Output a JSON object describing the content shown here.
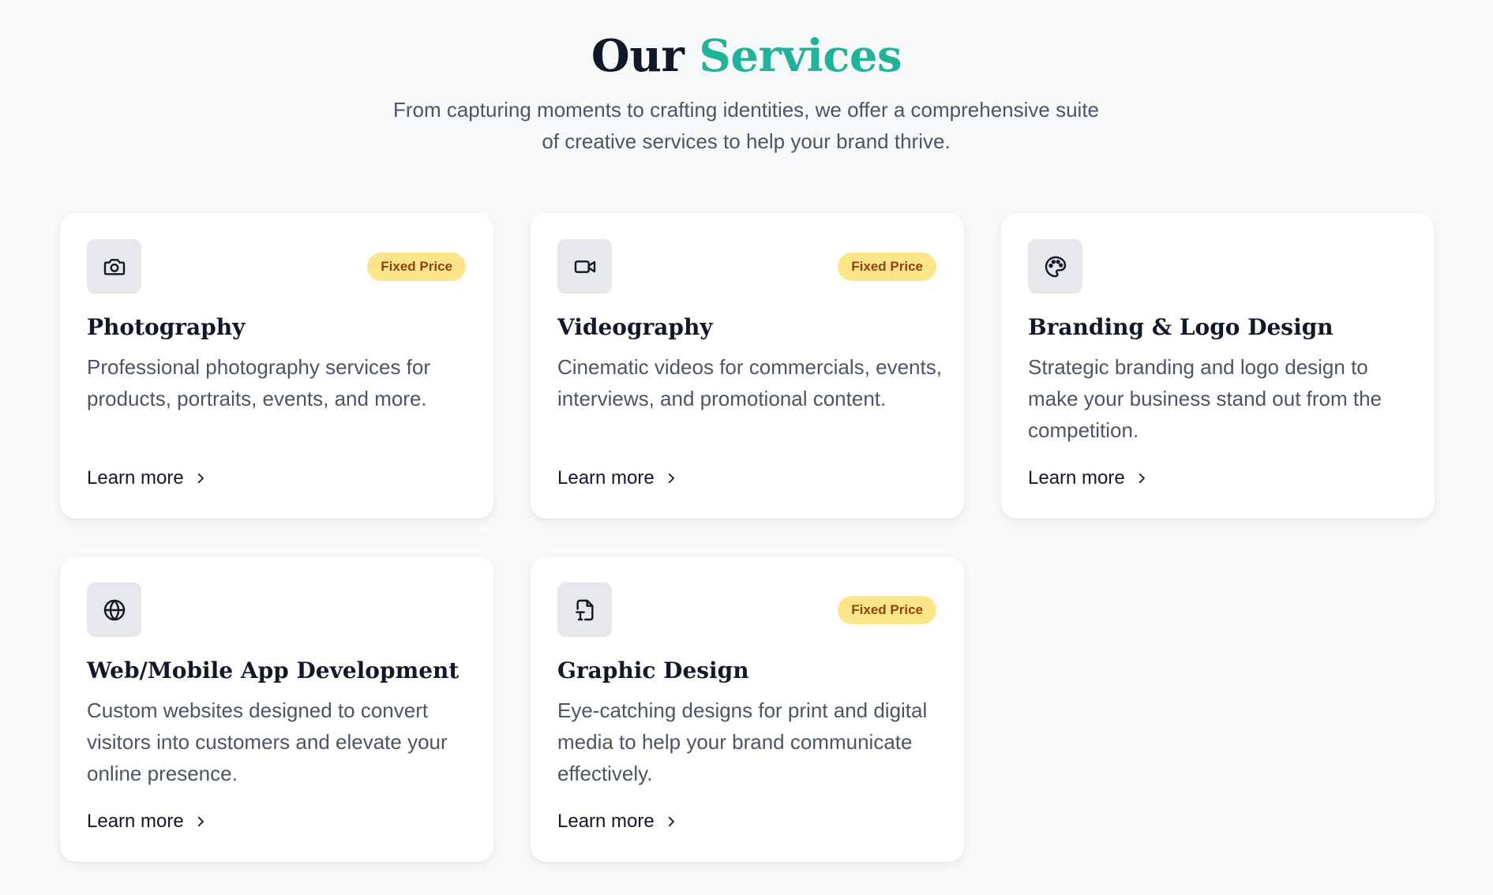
{
  "section": {
    "title_plain": "Our",
    "title_accent": "Services",
    "subtitle_line1": "From capturing moments to crafting identities, we offer a comprehensive suite",
    "subtitle_line2": "of creative services to help your brand thrive."
  },
  "colors": {
    "accent": "#1fb39a",
    "badge_bg": "#fde68a",
    "badge_text": "#92400e",
    "icon_bg": "#e6e8ec",
    "page_bg": "#f8f9fb"
  },
  "services": [
    {
      "icon": "camera-icon",
      "badge": "Fixed Price",
      "title": "Photography",
      "description": "Professional photography services for products, portraits, events, and more.",
      "link_label": "Learn more"
    },
    {
      "icon": "video-camera-icon",
      "badge": "Fixed Price",
      "title": "Videography",
      "description": "Cinematic videos for commercials, events, interviews, and promotional content.",
      "link_label": "Learn more"
    },
    {
      "icon": "palette-icon",
      "badge": "",
      "title": "Branding & Logo Design",
      "description": "Strategic branding and logo design to make your business stand out from the competition.",
      "link_label": "Learn more"
    },
    {
      "icon": "globe-icon",
      "badge": "",
      "title": "Web/Mobile App Development",
      "description": "Custom websites designed to convert visitors into customers and elevate your online presence.",
      "link_label": "Learn more"
    },
    {
      "icon": "file-type-icon",
      "badge": "Fixed Price",
      "title": "Graphic Design",
      "description": "Eye-catching designs for print and digital media to help your brand communicate effectively.",
      "link_label": "Learn more"
    }
  ]
}
